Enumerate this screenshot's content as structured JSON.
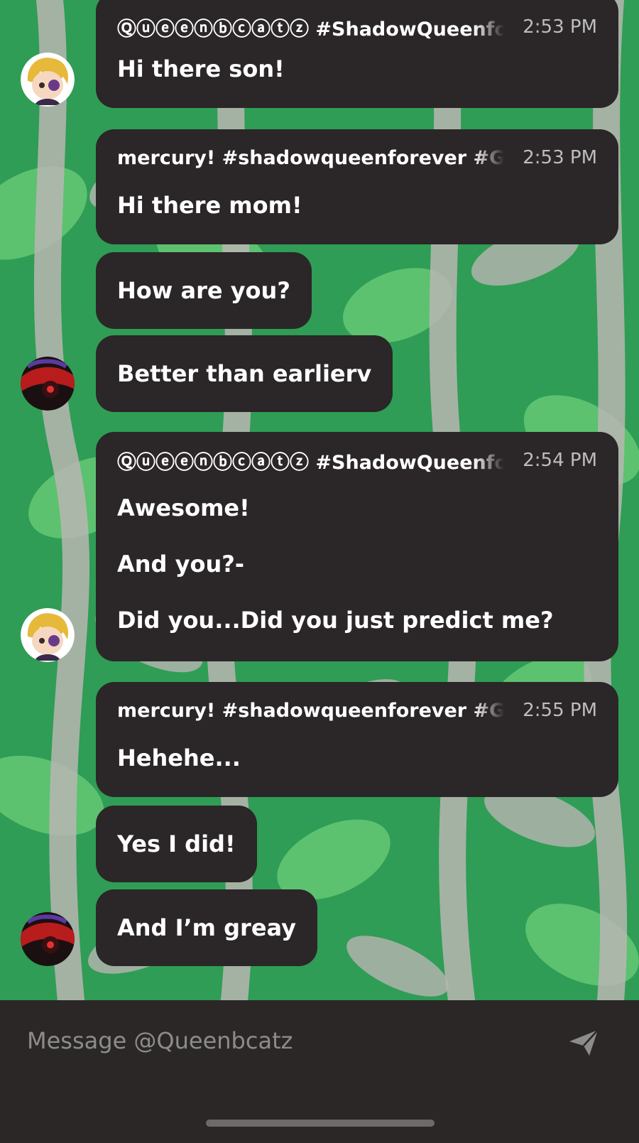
{
  "colors": {
    "bubble": "#2b2627",
    "wallpaper_green": "#2f9d55",
    "composer_bg": "#2b2727",
    "timestamp": "#bdbdbd"
  },
  "messages": [
    {
      "author": "Ⓠⓤⓔⓔⓝⓑⓒⓐⓣⓩ #ShadowQueenforever",
      "time": "2:53 PM",
      "lines": [
        "Hi there son!"
      ],
      "avatar": "blonde-character-avatar"
    },
    {
      "author": "mercury! #shadowqueenforever #GJforever",
      "time": "2:53 PM",
      "lines": [
        "Hi there mom!"
      ]
    },
    {
      "lines": [
        "How are you?"
      ]
    },
    {
      "lines": [
        "Better than earlierv"
      ],
      "avatar": "dark-red-character-avatar"
    },
    {
      "author": "Ⓠⓤⓔⓔⓝⓑⓒⓐⓣⓩ #ShadowQueenforever",
      "time": "2:54 PM",
      "lines": [
        "Awesome!",
        "And you?-",
        "Did you...Did you just predict me?"
      ],
      "avatar": "blonde-character-avatar"
    },
    {
      "author": "mercury! #shadowqueenforever #GJforever",
      "time": "2:55 PM",
      "lines": [
        "Hehehe..."
      ]
    },
    {
      "lines": [
        "Yes I did!"
      ]
    },
    {
      "lines": [
        "And I’m greay"
      ],
      "avatar": "dark-red-character-avatar"
    }
  ],
  "composer": {
    "placeholder": "Message @Queenbcatz",
    "send_icon": "paper-plane-icon"
  }
}
